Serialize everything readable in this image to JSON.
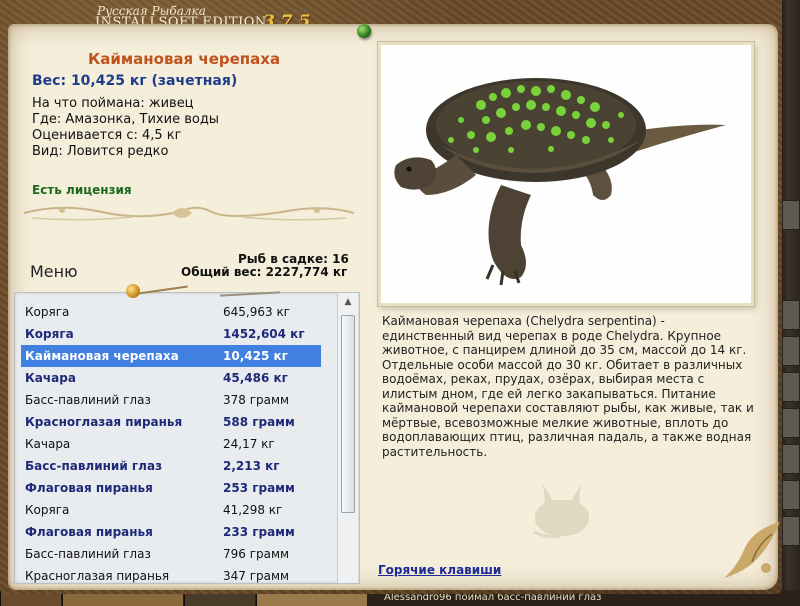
{
  "window": {
    "title_line1": "Русская Рыбалка",
    "title_line2": "INSTALLSOFT EDITION",
    "version": "3.7.5"
  },
  "fish": {
    "name": "Каймановая черепаха",
    "weight": "Вес: 10,425 кг (зачетная)",
    "caught_on": "На что поймана: живец",
    "where": "Где: Амазонка, Тихие воды",
    "valued_from": "Оценивается с: 4,5 кг",
    "kind": "Вид: Ловится редко",
    "license": "Есть лицензия"
  },
  "keepnet": {
    "count": "Рыб в садке: 16",
    "total_weight": "Общий вес: 2227,774 кг"
  },
  "menu_label": "Меню",
  "catch_list": [
    {
      "name": "Коряга",
      "weight": "645,963 кг",
      "bold": false,
      "selected": false
    },
    {
      "name": "Коряга",
      "weight": "1452,604 кг",
      "bold": true,
      "selected": false
    },
    {
      "name": "Каймановая черепаха",
      "weight": "10,425 кг",
      "bold": true,
      "selected": true
    },
    {
      "name": "Качара",
      "weight": "45,486 кг",
      "bold": true,
      "selected": false
    },
    {
      "name": "Басс-павлиний глаз",
      "weight": "378 грамм",
      "bold": false,
      "selected": false
    },
    {
      "name": "Красноглазая пиранья",
      "weight": "588 грамм",
      "bold": true,
      "selected": false
    },
    {
      "name": "Качара",
      "weight": "24,17 кг",
      "bold": false,
      "selected": false
    },
    {
      "name": "Басс-павлиний глаз",
      "weight": "2,213 кг",
      "bold": true,
      "selected": false
    },
    {
      "name": "Флаговая пиранья",
      "weight": "253 грамм",
      "bold": true,
      "selected": false
    },
    {
      "name": "Коряга",
      "weight": "41,298 кг",
      "bold": false,
      "selected": false
    },
    {
      "name": "Флаговая пиранья",
      "weight": "233 грамм",
      "bold": true,
      "selected": false
    },
    {
      "name": "Басс-павлиний глаз",
      "weight": "796 грамм",
      "bold": false,
      "selected": false
    },
    {
      "name": "Красноглазая пиранья",
      "weight": "347 грамм",
      "bold": false,
      "selected": false
    }
  ],
  "description": "Каймановая черепаха (Chelydra serpentina) - единственный вид черепах в роде Chelydra. Крупное животное, с панцирем длиной до 35 см, массой до 14 кг. Отдельные особи массой до 30 кг. Обитает в различных водоёмах, реках, прудах, озёрах, выбирая места с илистым дном, где ей легко закапываться. Питание каймановой черепахи составляют рыбы, как живые, так и мёртвые, всевозможные мелкие животные, вплоть до водоплавающих птиц, различная падаль, а также водная растительность.",
  "hotkeys_link": "Горячие клавиши",
  "background_fragments": {
    "bottom_text": "Alessandro96 поймал басс-павлиний глаз"
  },
  "colors": {
    "frame": "#6b4a28",
    "parchment": "#f4eedb",
    "title_orange": "#c0521c",
    "weight_blue": "#1e3c8c",
    "license_green": "#1a6a1a",
    "selection_blue": "#3f80e0",
    "bold_row_blue": "#1e2a78",
    "link_blue": "#1e2a9a",
    "version_gold": "#f0c040"
  },
  "icons": [
    "green-pushpin-icon",
    "gold-pushpin-icon",
    "scroll-up-arrow-icon",
    "turtle-photo",
    "turtle-watermark-icon",
    "corner-flourish-ornament"
  ]
}
